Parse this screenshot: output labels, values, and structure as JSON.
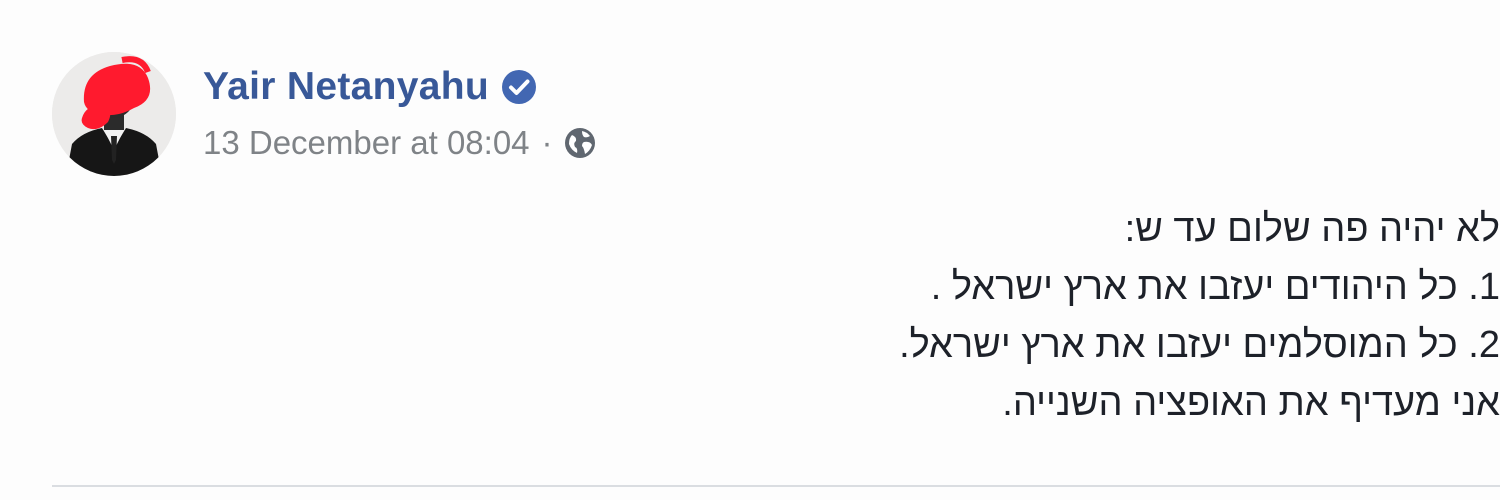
{
  "post": {
    "author_name": "Yair Netanyahu",
    "verified_icon": "verified-badge-icon",
    "timestamp": "13 December at 08:04",
    "separator": "·",
    "privacy_icon": "globe-icon",
    "body_lines": [
      "לא יהיה פה שלום עד ש:",
      "1. כל היהודים יעזבו את ארץ ישראל .",
      "2. כל המוסלמים יעזבו את ארץ ישראל.",
      "אני מעדיף את האופציה השנייה."
    ]
  },
  "colors": {
    "author_name": "#385898",
    "verified_badge": "#4267b2",
    "meta_text": "#7f8387",
    "body_text": "#1d2129",
    "redaction": "#ff1a2e"
  }
}
